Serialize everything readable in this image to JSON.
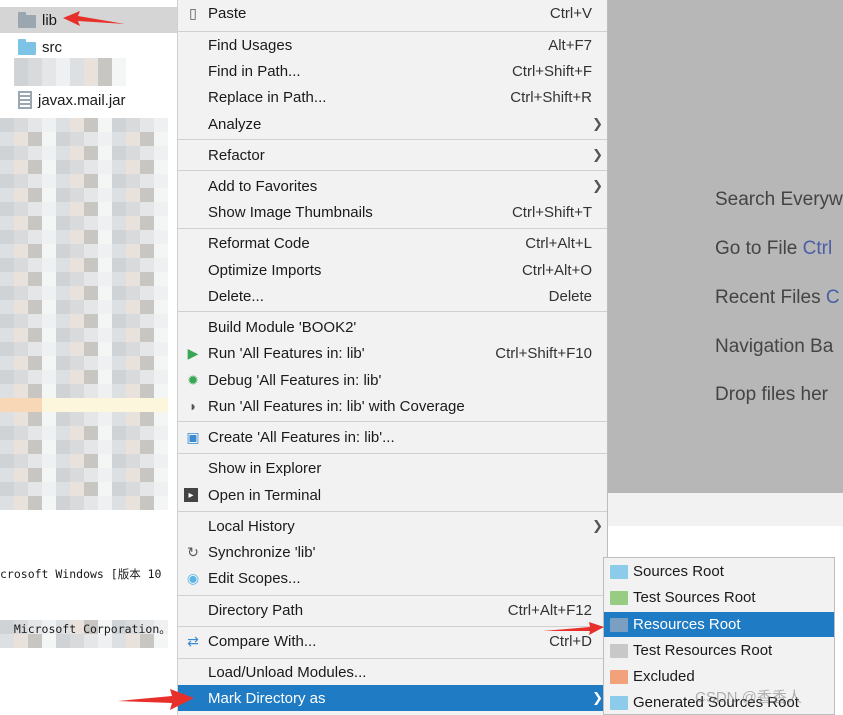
{
  "tree": {
    "items": [
      {
        "label": "lib",
        "selected": true,
        "icon": "folder-icon"
      },
      {
        "label": "src",
        "icon": "source-folder-icon"
      },
      {
        "label": "javax.mail.jar",
        "icon": "jar-icon"
      }
    ]
  },
  "console": {
    "lines": [
      "crosoft Windows [版本 10",
      "  Microsoft Corporation。"
    ]
  },
  "welcome": {
    "hints": [
      {
        "text": "Search Everyw",
        "key": ""
      },
      {
        "text": "Go to File ",
        "key": "Ctrl"
      },
      {
        "text": "Recent Files ",
        "key": "C"
      },
      {
        "text": "Navigation Ba",
        "key": ""
      },
      {
        "text": "Drop files her",
        "key": ""
      }
    ]
  },
  "menu": {
    "items": [
      {
        "label": "Paste",
        "shortcut": "Ctrl+V",
        "icon": "clipboard-icon"
      },
      {
        "sep": true
      },
      {
        "label": "Find Usages",
        "shortcut": "Alt+F7"
      },
      {
        "label": "Find in Path...",
        "shortcut": "Ctrl+Shift+F"
      },
      {
        "label": "Replace in Path...",
        "shortcut": "Ctrl+Shift+R"
      },
      {
        "label": "Analyze",
        "submenu": true
      },
      {
        "sep": true
      },
      {
        "label": "Refactor",
        "submenu": true
      },
      {
        "sep": true
      },
      {
        "label": "Add to Favorites",
        "submenu": true
      },
      {
        "label": "Show Image Thumbnails",
        "shortcut": "Ctrl+Shift+T"
      },
      {
        "sep": true
      },
      {
        "label": "Reformat Code",
        "shortcut": "Ctrl+Alt+L"
      },
      {
        "label": "Optimize Imports",
        "shortcut": "Ctrl+Alt+O"
      },
      {
        "label": "Delete...",
        "shortcut": "Delete"
      },
      {
        "sep": true
      },
      {
        "label": "Build Module 'BOOK2'"
      },
      {
        "label": "Run 'All Features in: lib'",
        "shortcut": "Ctrl+Shift+F10",
        "icon": "run-icon"
      },
      {
        "label": "Debug 'All Features in: lib'",
        "icon": "debug-icon"
      },
      {
        "label": "Run 'All Features in: lib' with Coverage",
        "icon": "coverage-icon"
      },
      {
        "sep": true
      },
      {
        "label": "Create 'All Features in: lib'...",
        "icon": "create-config-icon"
      },
      {
        "sep": true
      },
      {
        "label": "Show in Explorer"
      },
      {
        "label": "Open in Terminal",
        "icon": "terminal-icon"
      },
      {
        "sep": true
      },
      {
        "label": "Local History",
        "submenu": true
      },
      {
        "label": "Synchronize 'lib'",
        "icon": "sync-icon"
      },
      {
        "label": "Edit Scopes...",
        "icon": "scope-icon"
      },
      {
        "sep": true
      },
      {
        "label": "Directory Path",
        "shortcut": "Ctrl+Alt+F12"
      },
      {
        "sep": true
      },
      {
        "label": "Compare With...",
        "shortcut": "Ctrl+D",
        "icon": "compare-icon"
      },
      {
        "sep": true
      },
      {
        "label": "Load/Unload Modules..."
      },
      {
        "label": "Mark Directory as",
        "submenu": true,
        "highlighted": true
      }
    ]
  },
  "submenu": {
    "items": [
      {
        "label": "Sources Root",
        "color": "#8ccbea"
      },
      {
        "label": "Test Sources Root",
        "color": "#98cc82"
      },
      {
        "label": "Resources Root",
        "color": "#7a9fc0",
        "highlighted": true
      },
      {
        "label": "Test Resources Root",
        "color": "#c8c8c8"
      },
      {
        "label": "Excluded",
        "color": "#f2a27a"
      },
      {
        "label": "Generated Sources Root",
        "color": "#8ccbea"
      }
    ]
  },
  "watermark": "CSDN @香香人",
  "colors": {
    "accent": "#1e7bc4",
    "arrow": "#e8302a"
  }
}
